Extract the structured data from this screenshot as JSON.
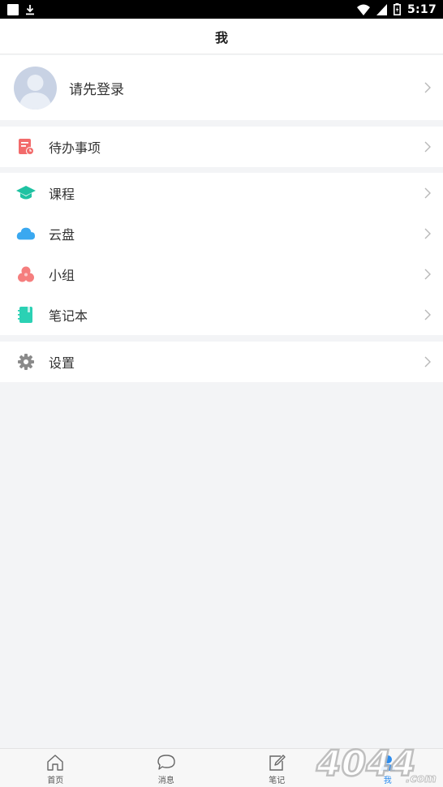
{
  "status_bar": {
    "time": "5:17"
  },
  "header": {
    "title": "我"
  },
  "profile": {
    "login_prompt": "请先登录"
  },
  "groups": [
    {
      "items": [
        {
          "label": "待办事项",
          "icon": "todo-icon",
          "color": "#f26b6b"
        }
      ]
    },
    {
      "items": [
        {
          "label": "课程",
          "icon": "graduation-cap-icon",
          "color": "#1fc2a2"
        },
        {
          "label": "云盘",
          "icon": "cloud-icon",
          "color": "#3aa8f0"
        },
        {
          "label": "小组",
          "icon": "group-icon",
          "color": "#f57e7e"
        },
        {
          "label": "笔记本",
          "icon": "notebook-icon",
          "color": "#2bd1b4"
        }
      ]
    },
    {
      "items": [
        {
          "label": "设置",
          "icon": "gear-icon",
          "color": "#8a8a8a"
        }
      ]
    }
  ],
  "bottom_nav": {
    "active_color": "#2a8cf0",
    "items": [
      {
        "label": "首页",
        "icon": "home-icon"
      },
      {
        "label": "消息",
        "icon": "chat-bubble-icon"
      },
      {
        "label": "笔记",
        "icon": "edit-note-icon"
      },
      {
        "label": "我",
        "icon": "user-icon",
        "active": true
      }
    ]
  },
  "watermark": {
    "text": "4044",
    "suffix": ".com"
  }
}
